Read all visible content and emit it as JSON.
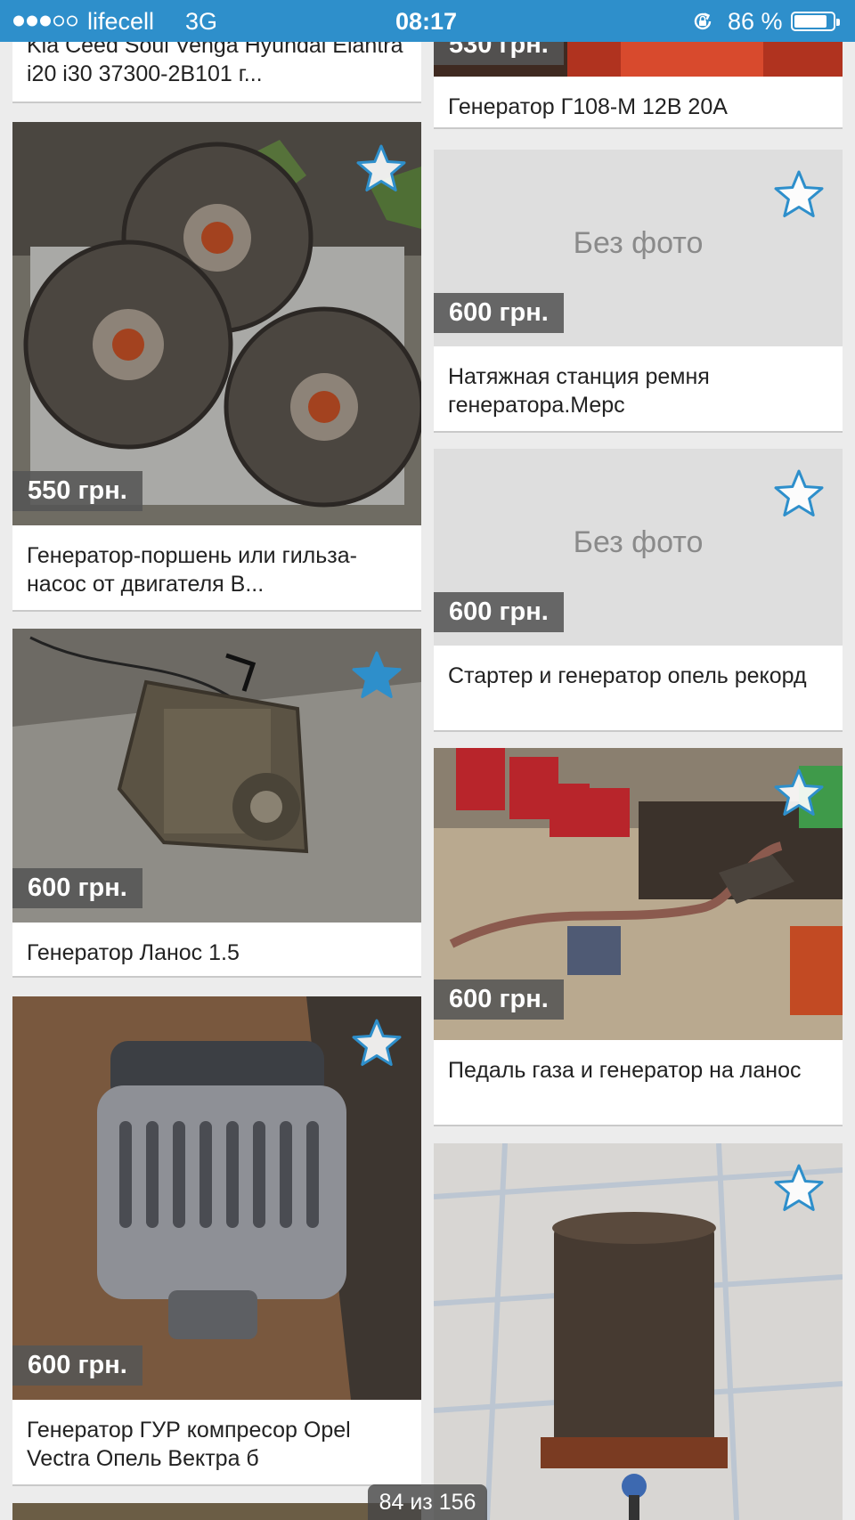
{
  "status_bar": {
    "carrier": "lifecell",
    "network": "3G",
    "time": "08:17",
    "battery": "86 %",
    "battery_level": 0.86
  },
  "listings": [
    {
      "title": "Kia Ceed Soul Venga Hyundai Elantra i20 i30 37300-2B101 г...",
      "favorited": false
    },
    {
      "title": "Генератор Г108-М 12В 20А",
      "price": "530 грн.",
      "favorited": false
    },
    {
      "title": "Генератор-поршень или гильза-насос от двигателя В...",
      "price": "550 грн.",
      "favorited": false
    },
    {
      "title": "Натяжная станция ремня генератора.Мерс",
      "price": "600 грн.",
      "no_photo": "Без фото",
      "favorited": false
    },
    {
      "title": "Генератор Ланос 1.5",
      "price": "600 грн.",
      "favorited": true
    },
    {
      "title": "Стартер и генератор опель рекорд",
      "price": "600 грн.",
      "no_photo": "Без фото",
      "favorited": false
    },
    {
      "title": "Педаль газа и генератор на ланос",
      "price": "600 грн.",
      "favorited": false
    },
    {
      "title": "Генератор ГУР компресор Opel Vectra Опель Вектра б",
      "price": "600 грн.",
      "favorited": false
    },
    {
      "title": "",
      "favorited": false
    }
  ],
  "pager": {
    "text": "84 из 156",
    "current": 84,
    "total": 156
  },
  "colors": {
    "accent": "#2e8fcb",
    "star": "#2e8fcb",
    "price_bg": "#555555"
  }
}
